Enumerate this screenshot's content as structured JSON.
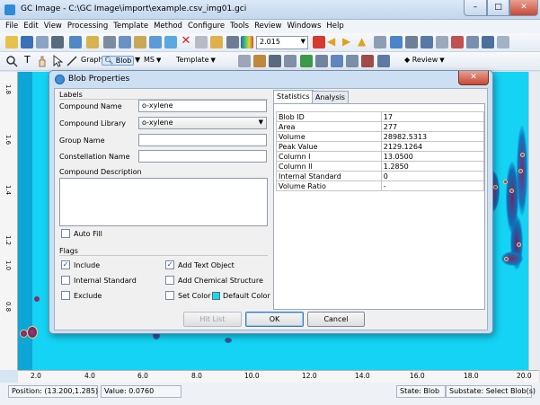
{
  "window": {
    "title": "GC Image - C:\\GC Image\\import\\example.csv_img01.gci",
    "minimize": "–",
    "maximize": "□",
    "close": "✕"
  },
  "menu": [
    "File",
    "Edit",
    "View",
    "Processing",
    "Template",
    "Method",
    "Configure",
    "Tools",
    "Review",
    "Windows",
    "Help"
  ],
  "toolbar1": {
    "zoom_value": "2.015"
  },
  "toolbar2": {
    "text_tool": "T",
    "graphic": "Graphic",
    "blob": "Blob",
    "ms": "MS",
    "template": "Template",
    "review": "Review"
  },
  "plot": {
    "y_ticks": [
      "1.8",
      "1.6",
      "1.4",
      "1.2",
      "1.0",
      "0.8"
    ],
    "x_ticks": [
      "2.0",
      "4.0",
      "6.0",
      "8.0",
      "10.0",
      "12.0",
      "14.0",
      "16.0",
      "18.0",
      "20.0"
    ],
    "colors": {
      "background": "#14d3f4",
      "blob_dark": "#6a2a6e",
      "blob_mid": "#b0307c"
    }
  },
  "status": {
    "position": "Position: (13.200,1.285)",
    "value": "Value: 0.0760",
    "state": "State: Blob",
    "substate": "Substate: Select Blob(s)"
  },
  "dialog": {
    "title": "Blob Properties",
    "close": "✕",
    "labels_section": "Labels",
    "compound_name_label": "Compound Name",
    "compound_name_value": "o-xylene",
    "compound_library_label": "Compound Library",
    "compound_library_value": "o-xylene",
    "group_name_label": "Group Name",
    "group_name_value": "",
    "constellation_name_label": "Constellation Name",
    "constellation_name_value": "",
    "compound_description_label": "Compound Description",
    "auto_fill": "Auto Fill",
    "flags_section": "Flags",
    "flags": {
      "include": {
        "label": "Include",
        "checked": true
      },
      "add_text_object": {
        "label": "Add Text Object",
        "checked": true
      },
      "internal_standard": {
        "label": "Internal Standard",
        "checked": false
      },
      "add_chemical_structure": {
        "label": "Add Chemical Structure",
        "checked": false
      },
      "exclude": {
        "label": "Exclude",
        "checked": false
      },
      "set_color": {
        "label": "Set Color",
        "checked": false
      },
      "default_color": "Default Color"
    },
    "tabs": [
      "Statistics",
      "Analysis"
    ],
    "statistics": [
      [
        "Blob ID",
        "17"
      ],
      [
        "Area",
        "277"
      ],
      [
        "Volume",
        "28982.5313"
      ],
      [
        "Peak Value",
        "2129.1264"
      ],
      [
        "Column I",
        "13.0500"
      ],
      [
        "Column II",
        "1.2850"
      ],
      [
        "Internal Standard",
        "0"
      ],
      [
        "Volume Ratio",
        "-"
      ]
    ],
    "buttons": {
      "hit_list": "Hit List",
      "ok": "OK",
      "cancel": "Cancel"
    }
  }
}
